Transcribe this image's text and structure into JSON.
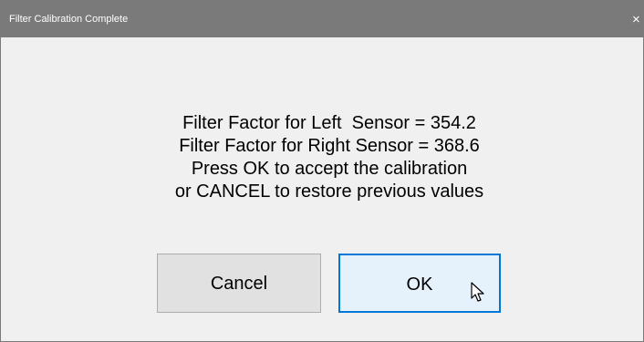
{
  "window": {
    "title": "Filter Calibration Complete",
    "close_glyph": "×"
  },
  "message": {
    "lines": [
      "Filter Factor for Left  Sensor = 354.2",
      "Filter Factor for Right Sensor = 368.6",
      "Press OK to accept the calibration",
      "or CANCEL to restore previous values"
    ]
  },
  "buttons": {
    "cancel_label": "Cancel",
    "ok_label": "OK"
  },
  "icons": {
    "close": "close-icon",
    "cursor": "arrow-cursor-icon"
  },
  "colors": {
    "titlebar": "#7a7a7a",
    "dialog_background": "#f0f0f0",
    "focus_border": "#0078d7"
  }
}
